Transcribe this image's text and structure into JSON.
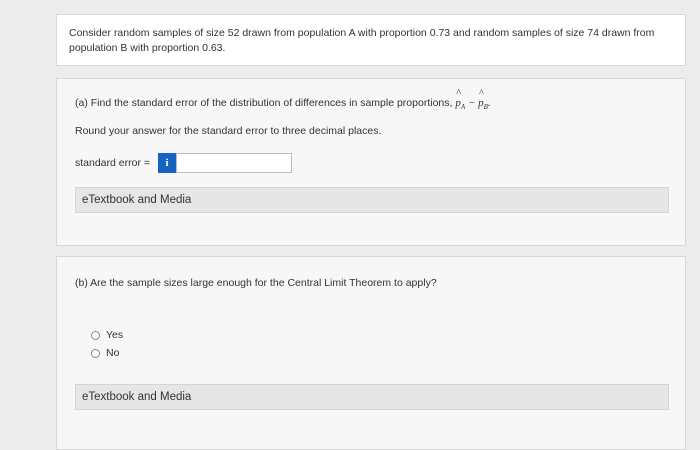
{
  "intro": {
    "text": "Consider random samples of size 52 drawn from population A with proportion 0.73 and random samples of size 74 drawn from population B with proportion 0.63."
  },
  "part_a": {
    "question_prefix": "(a) Find the standard error of the distribution of differences in sample proportions,",
    "p_symbol": "p",
    "sub_a": "A",
    "minus": "−",
    "sub_b": "B",
    "trailing_dot": ".",
    "instruction": "Round your answer for the standard error to three decimal places.",
    "answer_label": "standard error =",
    "info_button": "i",
    "answer_value": "",
    "etextbook_label": "eTextbook and Media"
  },
  "part_b": {
    "question": "(b) Are the sample sizes large enough for the Central Limit Theorem to apply?",
    "options": [
      "Yes",
      "No"
    ],
    "etextbook_label": "eTextbook and Media"
  }
}
